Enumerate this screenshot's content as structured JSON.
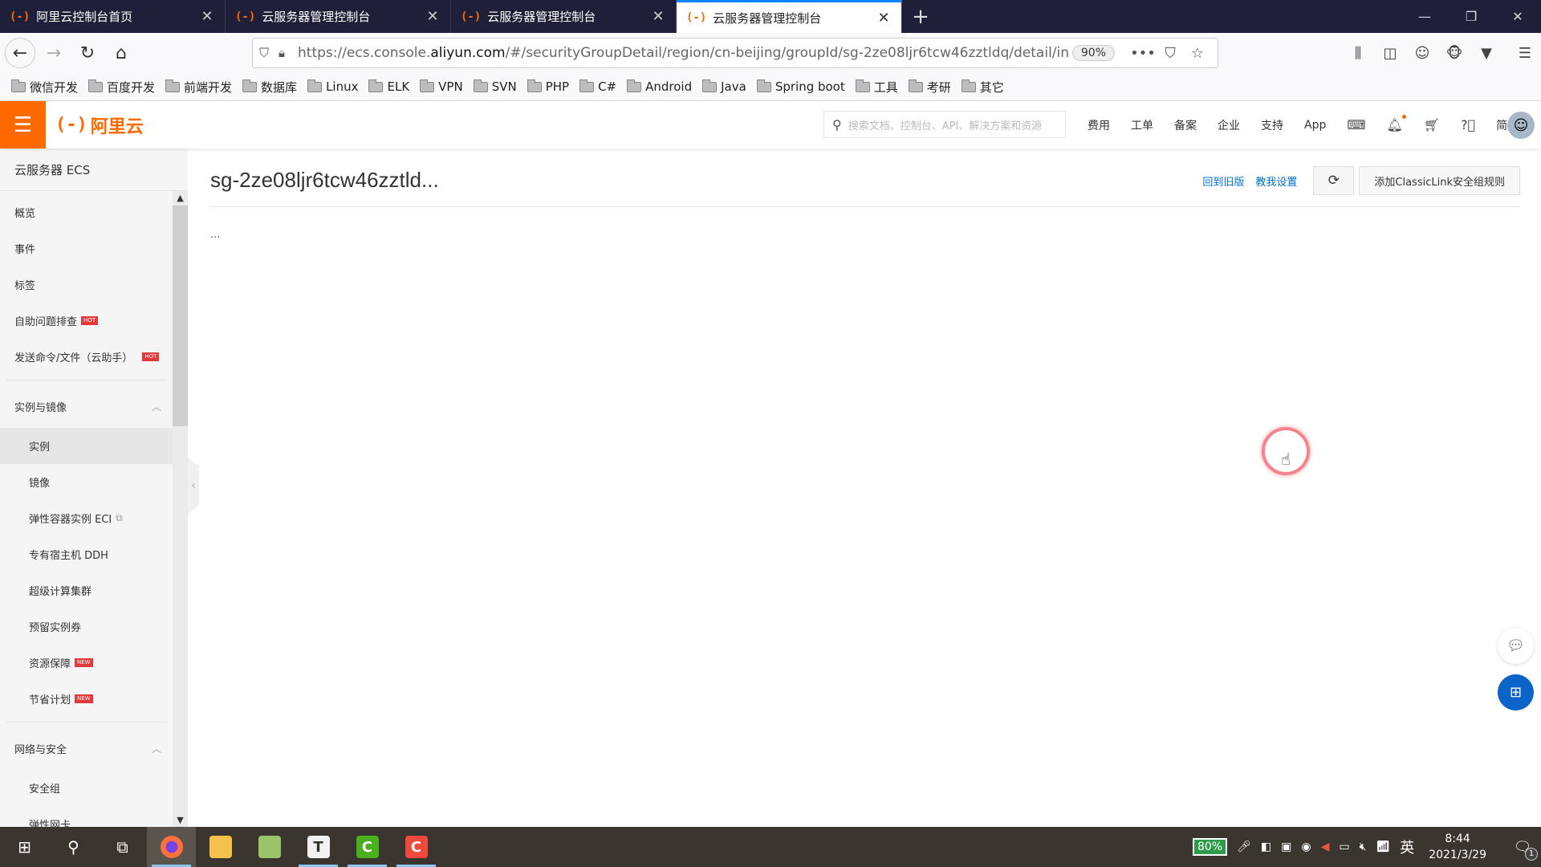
{
  "browser": {
    "tabs": [
      {
        "label": "阿里云控制台首页",
        "active": false
      },
      {
        "label": "云服务器管理控制台",
        "active": false
      },
      {
        "label": "云服务器管理控制台",
        "active": false
      },
      {
        "label": "云服务器管理控制台",
        "active": true
      }
    ],
    "url_prefix": "https://ecs.console.",
    "url_domain": "aliyun.com",
    "url_path": "/#/securityGroupDetail/region/cn-beijing/groupId/sg-2ze08ljr6tcw46zztldq/detail/in",
    "zoom": "90%",
    "bookmarks": [
      "微信开发",
      "百度开发",
      "前端开发",
      "数据库",
      "Linux",
      "ELK",
      "VPN",
      "SVN",
      "PHP",
      "C#",
      "Android",
      "Java",
      "Spring boot",
      "工具",
      "考研",
      "其它"
    ]
  },
  "topbar": {
    "logo": "阿里云",
    "search_placeholder": "搜索文档、控制台、API、解决方案和资源",
    "nav": [
      "费用",
      "工单",
      "备案",
      "企业",
      "支持",
      "App"
    ],
    "lang": "简体"
  },
  "sidebar": {
    "title": "云服务器 ECS",
    "top_items": [
      {
        "label": "概览"
      },
      {
        "label": "事件"
      },
      {
        "label": "标签"
      },
      {
        "label": "自助问题排查",
        "badge": "HOT"
      },
      {
        "label": "发送命令/文件（云助手）",
        "badge": "HOT"
      }
    ],
    "groups": [
      {
        "label": "实例与镜像",
        "items": [
          {
            "label": "实例",
            "active": true
          },
          {
            "label": "镜像"
          },
          {
            "label": "弹性容器实例 ECI",
            "external": true
          },
          {
            "label": "专有宿主机 DDH"
          },
          {
            "label": "超级计算集群"
          },
          {
            "label": "预留实例券"
          },
          {
            "label": "资源保障",
            "badge": "NEW"
          },
          {
            "label": "节省计划",
            "badge": "NEW"
          }
        ]
      },
      {
        "label": "网络与安全",
        "items": [
          {
            "label": "安全组"
          },
          {
            "label": "弹性网卡"
          }
        ]
      }
    ]
  },
  "main": {
    "title": "sg-2ze08ljr6tcw46zztld...",
    "back_old_version": "回到旧版",
    "teach_me": "教我设置",
    "add_rule_button": "添加ClassicLink安全组规则",
    "loading": "..."
  },
  "taskbar": {
    "battery": "80%",
    "ime": "英",
    "time": "8:44",
    "date": "2021/3/29",
    "notifications": "1"
  }
}
